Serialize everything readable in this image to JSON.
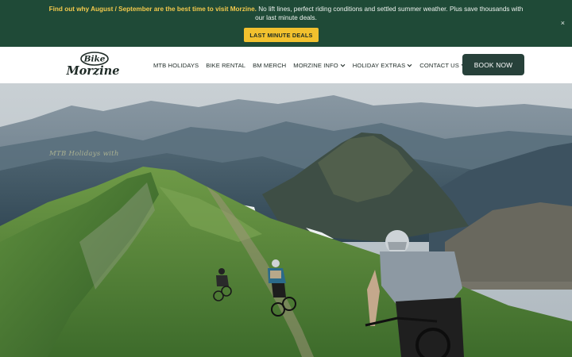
{
  "announcement": {
    "highlight": "Find out why August / September are the best time to visit Morzine.",
    "text": " No lift lines, perfect riding conditions and settled summer weather. Plus save thousands with our last minute deals.",
    "button_label": "LAST MINUTE DEALS",
    "close_label": "×"
  },
  "logo": {
    "line1": "Bike",
    "line2": "Morzine"
  },
  "nav": {
    "items": [
      {
        "label": "MTB HOLIDAYS",
        "dropdown": false
      },
      {
        "label": "BIKE RENTAL",
        "dropdown": false
      },
      {
        "label": "BM MERCH",
        "dropdown": false
      },
      {
        "label": "MORZINE INFO",
        "dropdown": true
      },
      {
        "label": "HOLIDAY EXTRAS",
        "dropdown": true
      },
      {
        "label": "CONTACT US",
        "dropdown": true
      }
    ],
    "book_label": "BOOK NOW"
  },
  "hero": {
    "overlay_text": "MTB Holidays with"
  },
  "colors": {
    "announce_bg": "#1f4a37",
    "highlight": "#f2c94c",
    "button_yellow": "#f2c12e",
    "book_bg": "#27413a"
  }
}
